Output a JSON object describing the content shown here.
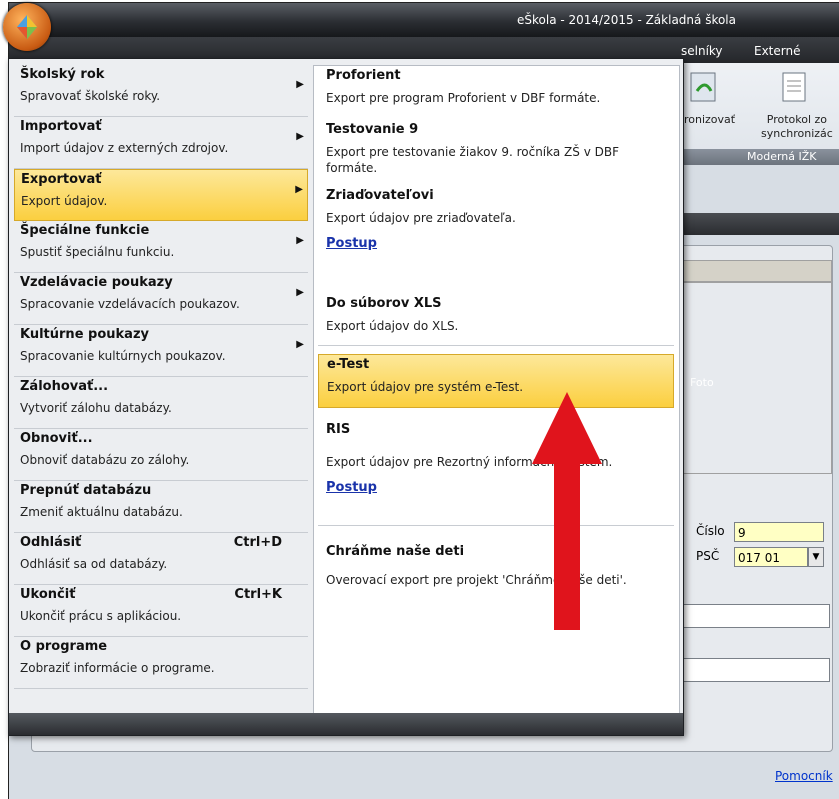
{
  "window": {
    "title": "eŠkola - 2014/2015 - Základná škola"
  },
  "tabs": [
    {
      "label": "selníky"
    },
    {
      "label": "Externé"
    }
  ],
  "ribbon": {
    "items": [
      {
        "label": "hronizovať"
      },
      {
        "label": "Protokol zo\nsynchronizác"
      }
    ],
    "group_label": "Moderná IŽK"
  },
  "form": {
    "cislo_label": "Číslo",
    "cislo_value": "9",
    "psc_label": "PSČ",
    "psc_value": "017 01",
    "foto_label": "Foto",
    "help_link": "Pomocník"
  },
  "menu": {
    "left_items": [
      {
        "title": "Školský rok",
        "desc": "Spravovať školské roky.",
        "submenu": true
      },
      {
        "title": "Importovať",
        "desc": "Import údajov z externých zdrojov.",
        "submenu": true
      },
      {
        "title": "Exportovať",
        "desc": "Export údajov.",
        "submenu": true,
        "highlighted": true
      },
      {
        "title": "Špeciálne funkcie",
        "desc": "Spustiť špeciálnu funkciu.",
        "submenu": true
      },
      {
        "title": "Vzdelávacie poukazy",
        "desc": "Spracovanie vzdelávacích poukazov.",
        "submenu": true
      },
      {
        "title": "Kultúrne poukazy",
        "desc": "Spracovanie kultúrnych poukazov.",
        "submenu": true
      },
      {
        "title": "Zálohovať...",
        "desc": "Vytvoriť zálohu databázy."
      },
      {
        "title": "Obnoviť...",
        "desc": "Obnoviť databázu zo zálohy."
      },
      {
        "title": "Prepnúť databázu",
        "desc": "Zmeniť aktuálnu databázu."
      },
      {
        "title": "Odhlásiť",
        "desc": "Odhlásiť sa od databázy.",
        "shortcut": "Ctrl+D"
      },
      {
        "title": "Ukončiť",
        "desc": "Ukončiť prácu s aplikáciou.",
        "shortcut": "Ctrl+K"
      },
      {
        "title": "O programe",
        "desc": "Zobraziť informácie o programe."
      }
    ],
    "export_items": [
      {
        "title": "Proforient",
        "desc": "Export pre program Proforient v DBF formáte."
      },
      {
        "title": "Testovanie 9",
        "desc": "Export pre testovanie žiakov 9. ročníka ZŠ v DBF formáte."
      },
      {
        "title": "Zriaďovateľovi",
        "desc": "Export údajov pre zriaďovateľa.",
        "link": "Postup"
      },
      {
        "title": "Do súborov XLS",
        "desc": "Export údajov do XLS."
      },
      {
        "title": "e-Test",
        "desc": "Export údajov pre systém e-Test.",
        "highlighted": true
      },
      {
        "title": "RIS",
        "desc": "Export údajov pre Rezortný informačný systém.",
        "link": "Postup"
      },
      {
        "title": "Chráňme naše deti",
        "desc": "Overovací export pre projekt 'Chráňme naše deti'."
      }
    ]
  },
  "colors": {
    "highlight": "#fbcf3f",
    "arrow": "#e0141c",
    "link": "#1a33aa"
  }
}
